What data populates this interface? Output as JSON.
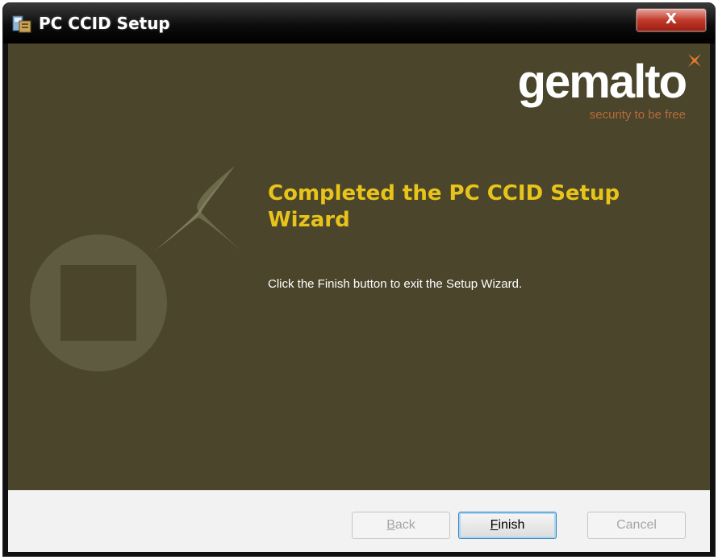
{
  "window": {
    "title": "PC CCID Setup",
    "close_glyph": "X"
  },
  "banner": {
    "logo": "gemalto",
    "tagline": "security to be free",
    "heading": "Completed the PC CCID Setup Wizard",
    "body": "Click the Finish button to exit the Setup Wizard."
  },
  "buttons": {
    "back": {
      "accesskey": "B",
      "rest": "ack",
      "enabled": false
    },
    "finish": {
      "accesskey": "F",
      "rest": "inish",
      "enabled": true
    },
    "cancel": {
      "label": "Cancel",
      "enabled": false
    }
  },
  "colors": {
    "banner_bg": "#4a452b",
    "heading": "#e8c41a",
    "tagline": "#b96a3a",
    "logo_star": "#e07a2e"
  },
  "icons": {
    "app": "installer-icon",
    "close": "close-icon",
    "logo_mark": "gemalto-star-icon"
  }
}
